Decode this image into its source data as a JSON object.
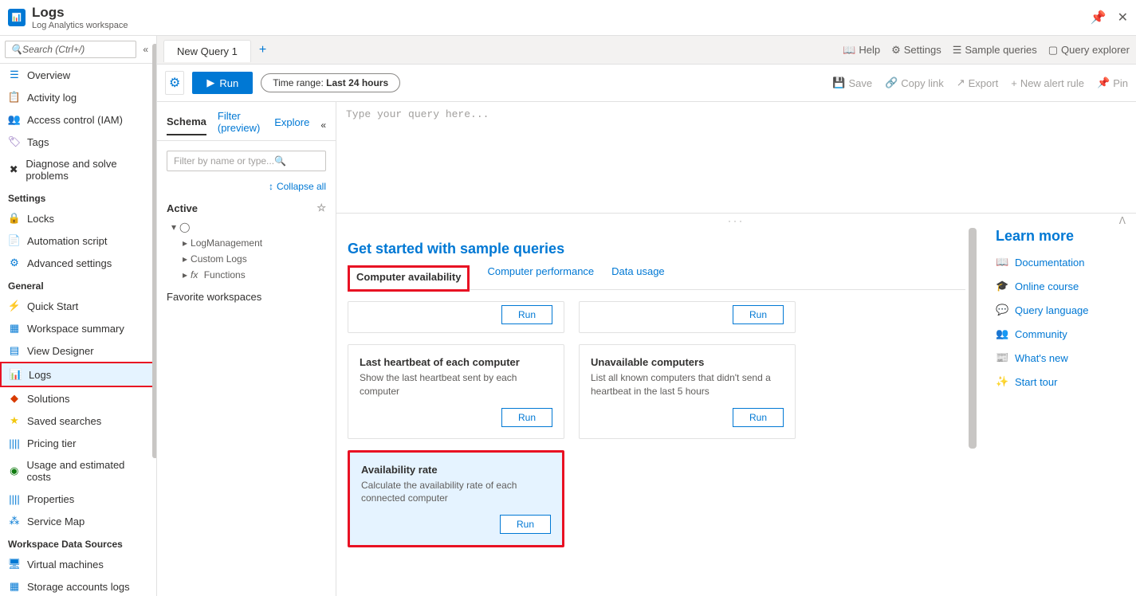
{
  "header": {
    "title": "Logs",
    "subtitle": "Log Analytics workspace"
  },
  "search_placeholder": "Search (Ctrl+/)",
  "nav": {
    "items": [
      "Overview",
      "Activity log",
      "Access control (IAM)",
      "Tags",
      "Diagnose and solve problems"
    ],
    "settings_header": "Settings",
    "settings_items": [
      "Locks",
      "Automation script",
      "Advanced settings"
    ],
    "general_header": "General",
    "general_items": [
      "Quick Start",
      "Workspace summary",
      "View Designer",
      "Logs",
      "Solutions",
      "Saved searches",
      "Pricing tier",
      "Usage and estimated costs",
      "Properties",
      "Service Map"
    ],
    "data_sources_header": "Workspace Data Sources",
    "data_sources_items": [
      "Virtual machines",
      "Storage accounts logs"
    ]
  },
  "tabs": {
    "new_query": "New Query 1"
  },
  "tabbar": {
    "help": "Help",
    "settings": "Settings",
    "sample_queries": "Sample queries",
    "query_explorer": "Query explorer"
  },
  "toolbar": {
    "run": "Run",
    "time_label": "Time range:",
    "time_value": " Last 24 hours",
    "save": "Save",
    "copy": "Copy link",
    "export": "Export",
    "alert": "New alert rule",
    "pin": "Pin"
  },
  "schema": {
    "tabs": [
      "Schema",
      "Filter (preview)",
      "Explore"
    ],
    "filter_placeholder": "Filter by name or type...",
    "collapse_all": "Collapse all",
    "active": "Active",
    "tree": [
      "LogManagement",
      "Custom Logs",
      "Functions"
    ],
    "fav": "Favorite workspaces"
  },
  "query_placeholder": "Type your query here...",
  "sample": {
    "title": "Get started with sample queries",
    "tabs": [
      "Computer availability",
      "Computer performance",
      "Data usage"
    ],
    "run_label": "Run",
    "cards": [
      {
        "title": "Last heartbeat of each computer",
        "desc": "Show the last heartbeat sent by each computer"
      },
      {
        "title": "Unavailable computers",
        "desc": "List all known computers that didn't send a heartbeat in the last 5 hours"
      },
      {
        "title": "Availability rate",
        "desc": "Calculate the availability rate of each connected computer"
      }
    ]
  },
  "learn": {
    "title": "Learn more",
    "links": [
      "Documentation",
      "Online course",
      "Query language",
      "Community",
      "What's new",
      "Start tour"
    ]
  }
}
